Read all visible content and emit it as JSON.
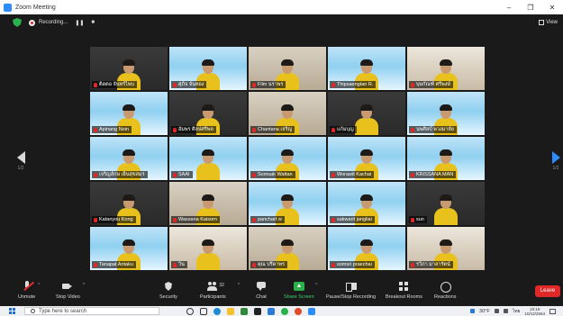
{
  "window": {
    "title": "Zoom Meeting",
    "controls": [
      "–",
      "❐",
      "✕"
    ]
  },
  "meeting_bar": {
    "recording_label": "Recording...",
    "pause_glyph": "❚❚",
    "stop_glyph": "■",
    "view_label": "View"
  },
  "gallery": {
    "page_left": "1/2",
    "page_right": "1/2",
    "tiles": [
      {
        "name": "ติดตอ จันทร์ไพบ",
        "bg": "dark"
      },
      {
        "name": "ศุภิจ จันทอง",
        "bg": "banner"
      },
      {
        "name": "Film นราพร",
        "bg": "room"
      },
      {
        "name": "Thipsaengtan R.",
        "bg": "banner"
      },
      {
        "name": "บุษกัณฑ์ ศรีพงษ์",
        "bg": "home"
      },
      {
        "name": "Apinang Noin",
        "bg": "banner"
      },
      {
        "name": "อัมพร ศิลปศรีพล",
        "bg": "dark"
      },
      {
        "name": "Chantana เจริญ",
        "bg": "room"
      },
      {
        "name": "แก้มบุญ",
        "bg": "dark"
      },
      {
        "name": "นพศิลป์ พวงมาลัย",
        "bg": "banner"
      },
      {
        "name": "เจริญลักษ เย็นสุขสมร",
        "bg": "banner"
      },
      {
        "name": "SAAI",
        "bg": "banner"
      },
      {
        "name": "Somsak Wattan",
        "bg": "banner"
      },
      {
        "name": "Worawit Kachai",
        "bg": "banner"
      },
      {
        "name": "KRISSANA MAN",
        "bg": "banner"
      },
      {
        "name": "Katanyou Kong",
        "bg": "dark"
      },
      {
        "name": "Wassana Kaisorn",
        "bg": "room"
      },
      {
        "name": "panchart w",
        "bg": "banner"
      },
      {
        "name": "sakwarit jangliai",
        "bg": "banner"
      },
      {
        "name": "sun",
        "bg": "dark"
      },
      {
        "name": "Tanapat Antaku",
        "bg": "banner"
      },
      {
        "name": "วิน",
        "bg": "home"
      },
      {
        "name": "คุณ ปรีดาพร",
        "bg": "room"
      },
      {
        "name": "somsri praechai",
        "bg": "banner"
      },
      {
        "name": "รวีภา มาลารัตน์",
        "bg": "home"
      }
    ]
  },
  "toolbar": {
    "unmute": "Unmute",
    "stop_video": "Stop Video",
    "security": "Security",
    "participants": "Participants",
    "participant_count": "32",
    "chat": "Chat",
    "share_screen": "Share Screen",
    "record": "Pause/Stop Recording",
    "breakout": "Breakout Rooms",
    "reactions": "Reactions",
    "leave": "Leave"
  },
  "taskbar": {
    "search_placeholder": "Type here to search",
    "weather": "30°F",
    "language": "ไทย",
    "time": "10:19",
    "date": "10/12/2564"
  },
  "colors": {
    "zoom_blue": "#2d8cff",
    "share_green": "#2bb24c",
    "leave_red": "#e02828",
    "speaker_outline": "#ffd700"
  }
}
